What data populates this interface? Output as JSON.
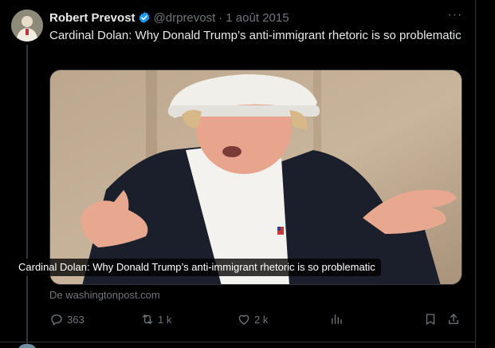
{
  "tweet": {
    "author_name": "Robert Prevost",
    "handle": "@drprevost",
    "separator": "·",
    "date": "1 août 2015",
    "more_glyph": "···",
    "text": "Cardinal Dolan: Why Donald Trump’s anti-immigrant rhetoric is so problematic",
    "card": {
      "caption": "Cardinal Dolan: Why Donald Trump’s anti-immigrant rhetoric is so problematic",
      "source": "De washingtonpost.com"
    },
    "actions": {
      "replies": "363",
      "retweets": "1 k",
      "likes": "2 k"
    }
  },
  "icons": {
    "verified": "verified-badge-icon",
    "reply": "reply-icon",
    "retweet": "retweet-icon",
    "like": "heart-icon",
    "views": "analytics-icon",
    "bookmark": "bookmark-icon",
    "share": "share-icon"
  },
  "colors": {
    "background": "#000000",
    "text": "#e7e9ea",
    "muted": "#71767b",
    "verified": "#1d9bf0",
    "border": "#2f3336"
  }
}
